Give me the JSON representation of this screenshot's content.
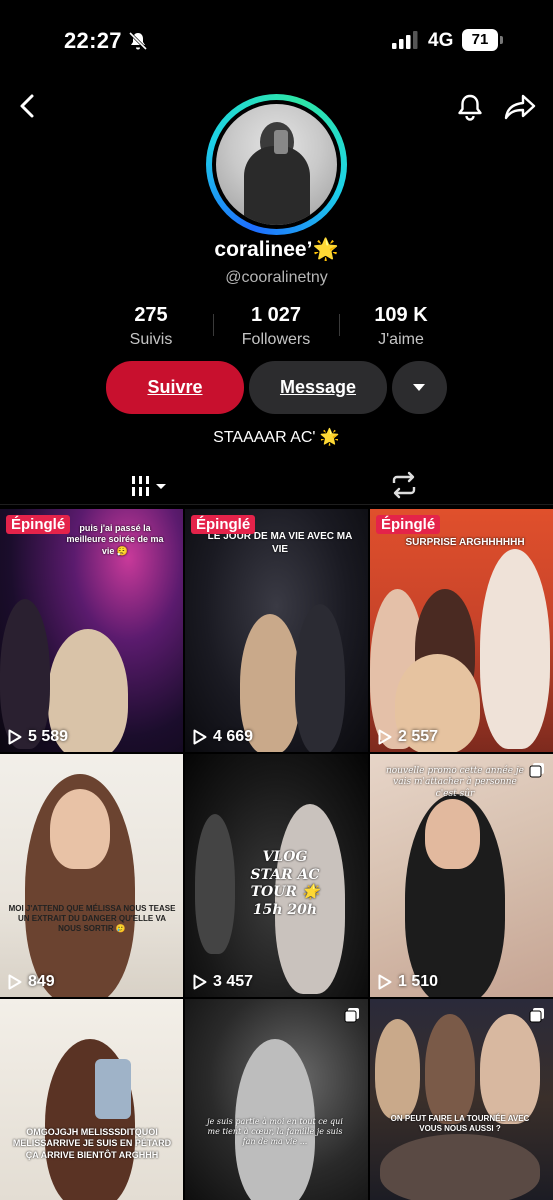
{
  "status": {
    "time": "22:27",
    "network": "4G",
    "battery": "71"
  },
  "profile": {
    "display_name": "coralinee’🌟",
    "handle": "@cooralinetny",
    "bio": "STAAAAR AC' 🌟"
  },
  "stats": [
    {
      "value": "275",
      "label": "Suivis"
    },
    {
      "value": "1 027",
      "label": "Followers"
    },
    {
      "value": "109 K",
      "label": "J'aime"
    }
  ],
  "actions": {
    "follow": "Suivre",
    "message": "Message"
  },
  "videos": [
    {
      "pinned": "Épinglé",
      "views": "5 589",
      "caption": "puis j'ai passé la meilleure soirée de ma vie 😮‍💨"
    },
    {
      "pinned": "Épinglé",
      "views": "4 669",
      "caption": "LE JOUR DE MA VIE AVEC MA VIE"
    },
    {
      "pinned": "Épinglé",
      "views": "2 557",
      "caption": "SURPRISE ARGHHHHHH"
    },
    {
      "views": "849",
      "caption": "MOI J'ATTEND QUE MÉLISSA NOUS TEASE UN EXTRAIT DU DANGER QU'ELLE VA NOUS SORTIR 🥲"
    },
    {
      "views": "3 457",
      "caption": "VLOG STAR AC TOUR 🌟 15h 20h"
    },
    {
      "views": "1 510",
      "caption": "nouvelle promo cette année je vais m'attacher à personne c'est sûr"
    },
    {
      "views": "",
      "caption": "OMGOJGJH MELISSSDITQUOI MELISSARRIVE JE SUIS EN PÉTARD ÇA ARRIVE BIENTÔT ARGHHH"
    },
    {
      "views": "",
      "caption": "je suis partie à moi en tout ce qui me tient à cœur, la famille je suis fan de ma vie ..."
    },
    {
      "views": "",
      "caption": "ON PEUT FAIRE LA TOURNÉE AVEC VOUS NOUS AUSSI ?"
    }
  ]
}
